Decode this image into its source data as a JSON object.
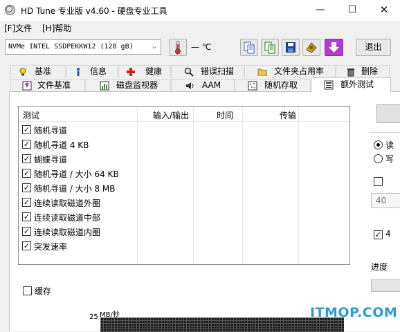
{
  "window": {
    "title": "HD Tune 专业版 v4.60 - 硬盘专业工具",
    "minimize": "—",
    "maximize": "☐",
    "close": "✕"
  },
  "menu": {
    "file": "[F]文件",
    "help": "[H]帮助"
  },
  "toolbar": {
    "drive": "NVMe   INTEL SSDPEKKW12 (128 gB)",
    "temperature": "— ℃",
    "exit": "退出"
  },
  "tabs_row1": [
    {
      "label": "基准",
      "icon": "lightbulb-icon"
    },
    {
      "label": "信息",
      "icon": "info-icon"
    },
    {
      "label": "健康",
      "icon": "red-cross-icon"
    },
    {
      "label": "错误扫描",
      "icon": "magnifier-icon"
    },
    {
      "label": "文件夹占用率",
      "icon": "folder-icon"
    },
    {
      "label": "删除",
      "icon": "trash-icon"
    }
  ],
  "tabs_row2": [
    {
      "label": "文件基准",
      "icon": "file-benchmark-icon"
    },
    {
      "label": "磁盘监视器",
      "icon": "chart-icon"
    },
    {
      "label": "AAM",
      "icon": "speaker-icon"
    },
    {
      "label": "随机存取",
      "icon": "random-access-icon"
    },
    {
      "label": "额外测试",
      "icon": "extra-tests-icon",
      "active": true
    }
  ],
  "list": {
    "headers": {
      "test": "测试",
      "io": "输入/输出",
      "time": "时间",
      "transfer": "传输"
    },
    "rows": [
      {
        "label": "随机寻道",
        "checked": true
      },
      {
        "label": "随机寻道 4 KB",
        "checked": true
      },
      {
        "label": "蝴蝶寻道",
        "checked": true
      },
      {
        "label": "随机寻道 / 大小 64 KB",
        "checked": true
      },
      {
        "label": "随机寻道 / 大小 8 MB",
        "checked": true
      },
      {
        "label": "连续读取磁道外圈",
        "checked": true
      },
      {
        "label": "连续读取磁道中部",
        "checked": true
      },
      {
        "label": "连续读取磁道内圈",
        "checked": true
      },
      {
        "label": "突发速率",
        "checked": true
      }
    ]
  },
  "cache_label": "缓存",
  "graph": {
    "unit": "MB/秒",
    "y_tick": "25"
  },
  "right_panel": {
    "radio1": "读",
    "radio2": "写",
    "check1": "",
    "number_value": "40",
    "check2": "4",
    "progress_label": "进度"
  },
  "watermark": "ITMOP.COM"
}
